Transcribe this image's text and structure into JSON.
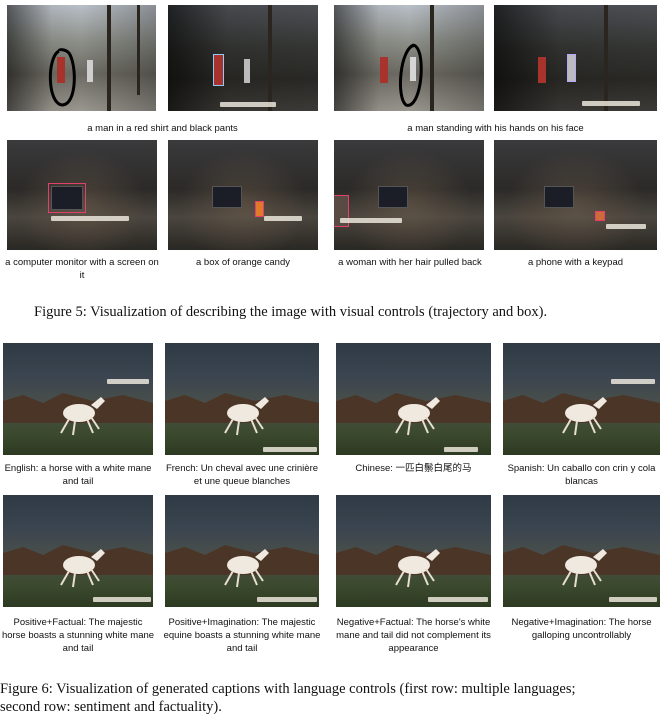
{
  "figure5": {
    "row1_captions": [
      "a man in a red shirt and black pants",
      "a man standing with his hands on his face"
    ],
    "row2_captions": [
      "a computer monitor with a screen on it",
      "a box of orange candy",
      "a woman with her hair pulled back",
      "a phone with a keypad"
    ],
    "caption": "Figure 5: Visualization of describing the image with visual controls (trajectory and box)."
  },
  "figure6": {
    "row1_captions": [
      "English: a horse with a white mane and tail",
      "French: Un cheval avec une crinière et une queue blanches",
      "Chinese: 一匹白鬃白尾的马",
      "Spanish: Un caballo con crin y cola blancas"
    ],
    "row2_captions": [
      "Positive+Factual: The majestic horse boasts a stunning white mane and tail",
      "Positive+Imagination: The majestic equine boasts a stunning white mane and tail",
      "Negative+Factual: The horse's white mane and tail did not complement its appearance",
      "Negative+Imagination: The horse galloping uncontrollably"
    ],
    "caption_line1": "Figure 6: Visualization of generated captions with language controls (first row: multiple languages;",
    "caption_line2": "second row: sentiment and factuality)."
  },
  "colors": {
    "trajectory": "#000000",
    "box_outline": "#e0406a"
  }
}
